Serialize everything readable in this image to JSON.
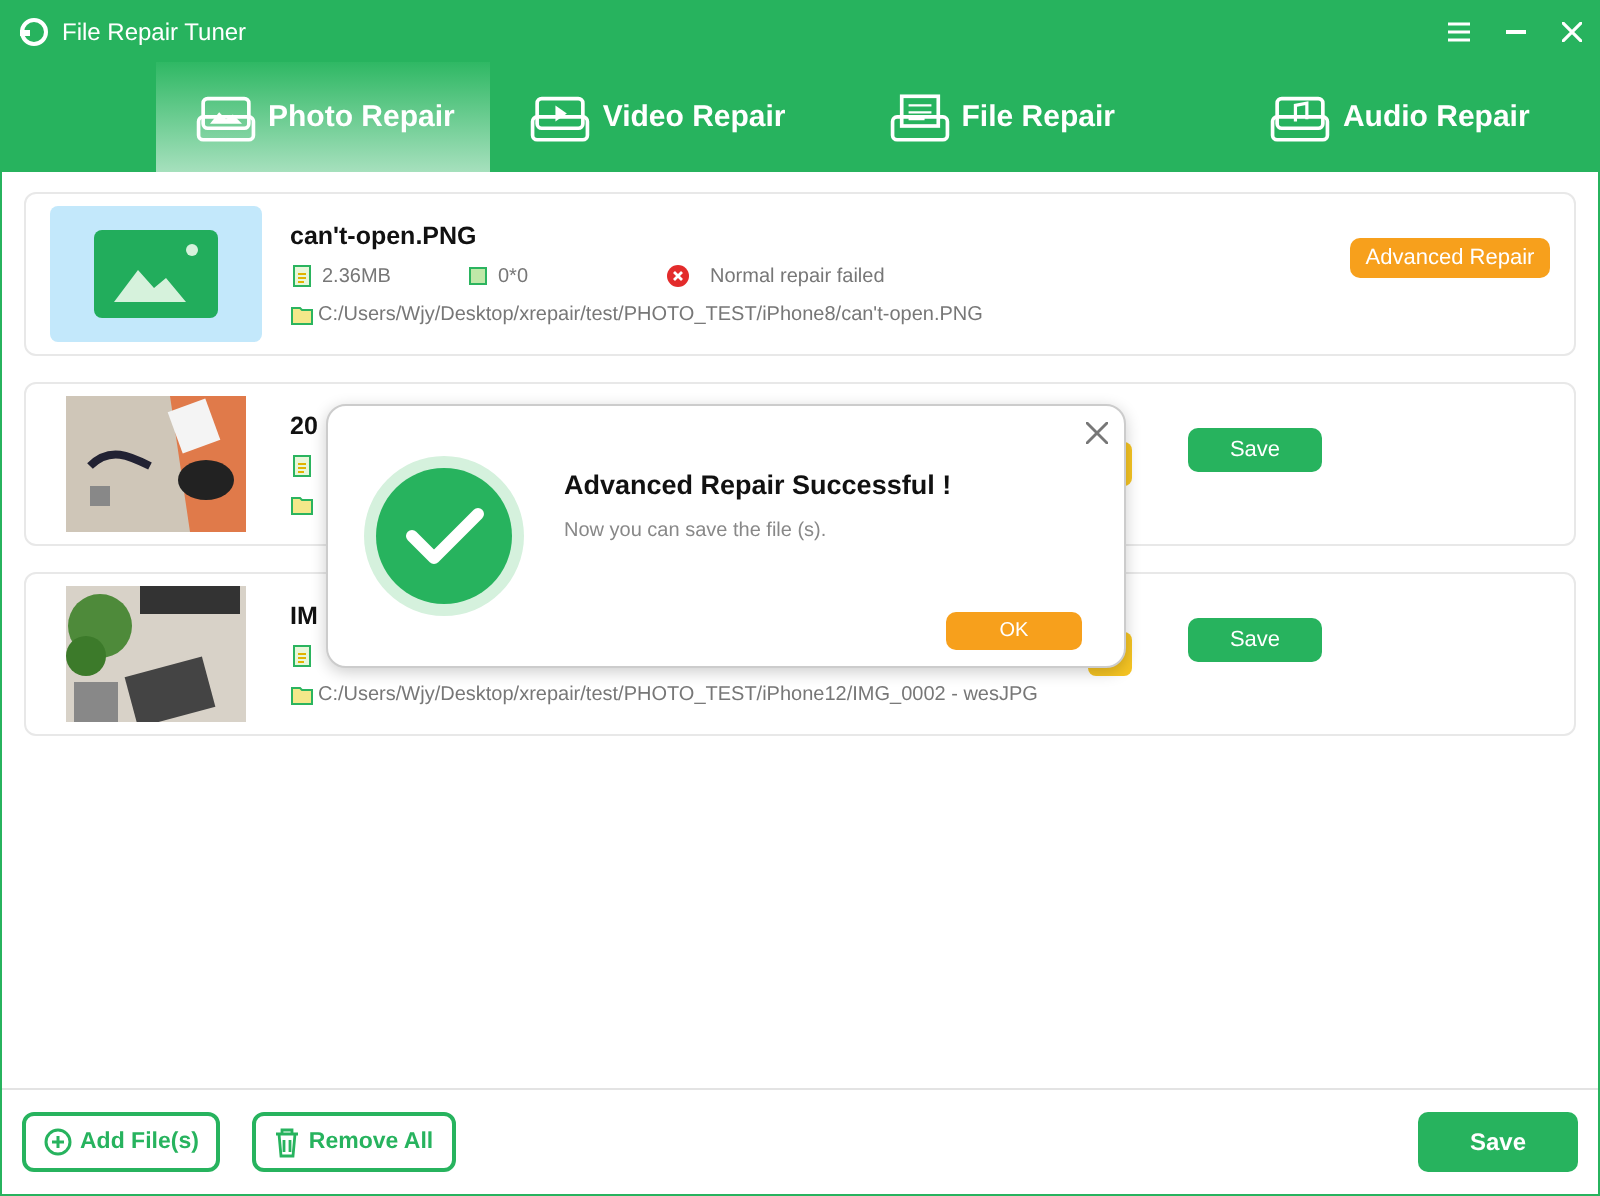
{
  "window": {
    "title": "File Repair Tuner"
  },
  "tabs": [
    {
      "label": "Photo Repair",
      "selected": true
    },
    {
      "label": "Video Repair",
      "kind": "video",
      "selected": false
    },
    {
      "label": "File Repair",
      "kind": "file",
      "selected": false
    },
    {
      "label": "Audio Repair",
      "kind": "audio",
      "selected": false
    }
  ],
  "files": [
    {
      "kind": "failed",
      "name": "can't-open.PNG",
      "size": "2.36MB",
      "dimensions": "0*0",
      "status": "Normal repair failed",
      "path": "C:/Users/Wjy/Desktop/xrepair/test/PHOTO_TEST/iPhone8/can't-open.PNG",
      "action": "Advanced Repair"
    },
    {
      "kind": "covered",
      "name": "20",
      "save": "Save"
    },
    {
      "kind": "covered",
      "name": "IM",
      "path": "C:/Users/Wjy/Desktop/xrepair/test/PHOTO_TEST/iPhone12/IMG_0002 - wesJPG",
      "save": "Save"
    }
  ],
  "dialog": {
    "title": "Advanced Repair Successful !",
    "message": "Now you can save the file (s).",
    "button": "OK"
  },
  "footer": {
    "add": "Add File(s)",
    "remove": "Remove All",
    "save": "Save"
  }
}
